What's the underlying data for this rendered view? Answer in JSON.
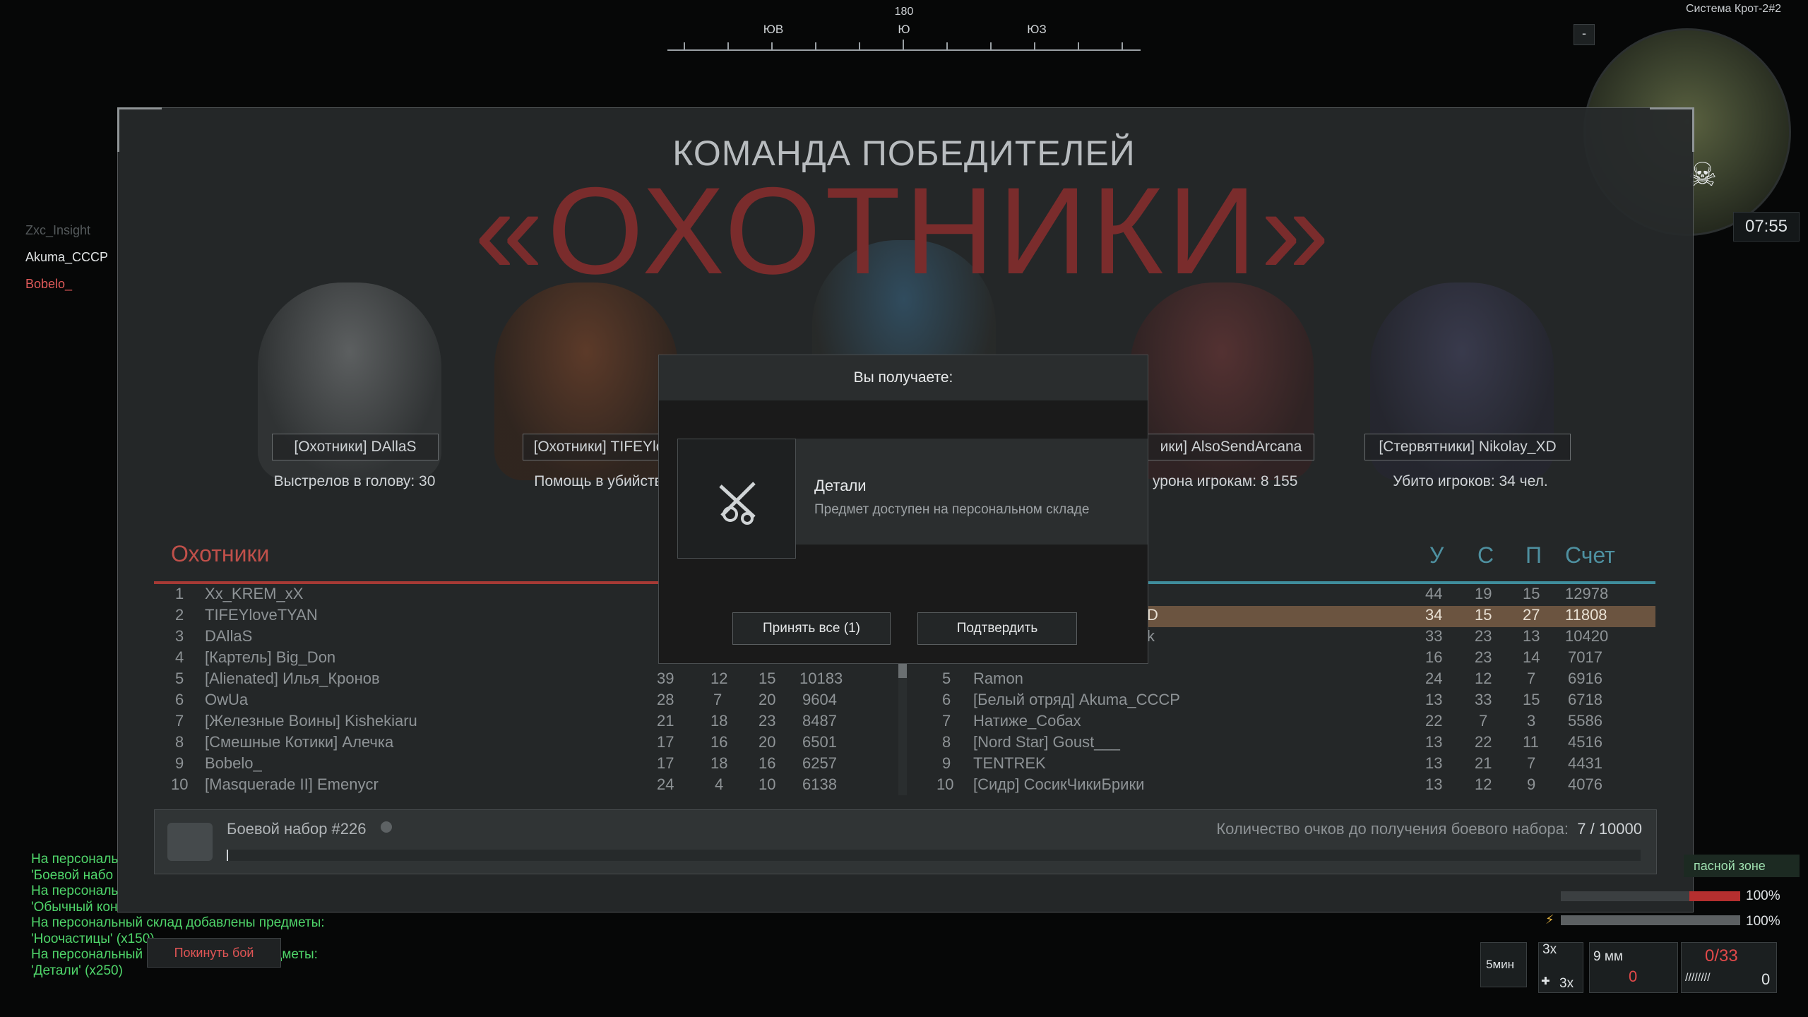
{
  "compass": {
    "degree": "180",
    "labels": [
      {
        "text": "ЮВ"
      },
      {
        "text": "Ю"
      },
      {
        "text": "ЮЗ"
      }
    ]
  },
  "minimap": {
    "title": "Система Крот-2#2",
    "zoom_out": "-",
    "time": "07:55"
  },
  "squad": [
    {
      "name": "Zxc_Insight",
      "color": "#555a5c"
    },
    {
      "name": "Akuma_CCCP",
      "color": "#e2e5e6"
    },
    {
      "name": "Bobelo_",
      "color": "#e05a5a"
    }
  ],
  "winner": {
    "subtitle": "КОМАНДА ПОБЕДИТЕЛЕЙ",
    "team": "«ОХОТНИКИ»"
  },
  "mvp": [
    {
      "player": "[Охотники] DAllaS",
      "stat": "Выстрелов в голову: 30"
    },
    {
      "player": "[Охотники] TIFEYlo",
      "stat": "Помощь в убийств"
    },
    {
      "player": "ики] AlsoSendArcana",
      "stat": "урона игрокам: 8 155"
    },
    {
      "player": "[Стервятники] Nikolay_XD",
      "stat": "Убито игроков: 34 чел."
    }
  ],
  "left_team": {
    "name": "Охотники",
    "rows": [
      {
        "n": "1",
        "name": "Xx_KREM_xX",
        "k": "",
        "d": "",
        "a": "",
        "s": ""
      },
      {
        "n": "2",
        "name": "TIFEYloveTYAN",
        "k": "",
        "d": "",
        "a": "",
        "s": ""
      },
      {
        "n": "3",
        "name": "DAllaS",
        "k": "",
        "d": "",
        "a": "",
        "s": ""
      },
      {
        "n": "4",
        "name": "[Картель] Big_Don",
        "k": "",
        "d": "",
        "a": "",
        "s": ""
      },
      {
        "n": "5",
        "name": "[Alienated] Илья_Кронов",
        "k": "39",
        "d": "12",
        "a": "15",
        "s": "10183"
      },
      {
        "n": "6",
        "name": "OwUa",
        "k": "28",
        "d": "7",
        "a": "20",
        "s": "9604"
      },
      {
        "n": "7",
        "name": "[Железные Воины] Kishekiaru",
        "k": "21",
        "d": "18",
        "a": "23",
        "s": "8487"
      },
      {
        "n": "8",
        "name": "[Смешные Котики] Алечка",
        "k": "17",
        "d": "16",
        "a": "20",
        "s": "6501"
      },
      {
        "n": "9",
        "name": "Bobelo_",
        "k": "17",
        "d": "18",
        "a": "16",
        "s": "6257"
      },
      {
        "n": "10",
        "name": "[Masquerade II] Emenycr",
        "k": "24",
        "d": "4",
        "a": "10",
        "s": "6138"
      }
    ]
  },
  "right_team": {
    "columns": {
      "kills": "У",
      "deaths": "С",
      "assists": "П",
      "score": "Счет"
    },
    "rows": [
      {
        "n": "",
        "name": "",
        "k": "44",
        "d": "19",
        "a": "15",
        "s": "12978"
      },
      {
        "n": "",
        "name": "D",
        "k": "34",
        "d": "15",
        "a": "27",
        "s": "11808"
      },
      {
        "n": "",
        "name": "k",
        "k": "33",
        "d": "23",
        "a": "13",
        "s": "10420"
      },
      {
        "n": "",
        "name": "",
        "k": "16",
        "d": "23",
        "a": "14",
        "s": "7017"
      },
      {
        "n": "5",
        "name": "Ramon",
        "k": "24",
        "d": "12",
        "a": "7",
        "s": "6916"
      },
      {
        "n": "6",
        "name": "[Белый отряд] Akuma_CCCP",
        "k": "13",
        "d": "33",
        "a": "15",
        "s": "6718"
      },
      {
        "n": "7",
        "name": "Натиже_Собах",
        "k": "22",
        "d": "7",
        "a": "3",
        "s": "5586"
      },
      {
        "n": "8",
        "name": "[Nord Star] Goust___",
        "k": "13",
        "d": "22",
        "a": "11",
        "s": "4516"
      },
      {
        "n": "9",
        "name": "TENTREK",
        "k": "13",
        "d": "21",
        "a": "7",
        "s": "4431"
      },
      {
        "n": "10",
        "name": "[Сидр] СосикЧикиБрики",
        "k": "13",
        "d": "12",
        "a": "9",
        "s": "4076"
      }
    ]
  },
  "kit": {
    "name": "Боевой набор #226",
    "points_label": "Количество очков до получения боевого набора:",
    "points_value": "7 / 10000",
    "progress": 0.0007
  },
  "reward": {
    "title": "Вы получаете:",
    "item_name": "Детали",
    "item_desc": "Предмет доступен на персональном складе",
    "accept_all": "Принять все (1)",
    "confirm": "Подтвердить"
  },
  "chat": [
    "На персональ",
    "'Боевой набо",
    "На персональ",
    "'Обычный кон",
    "На персональный склад добавлены предметы:",
    "'Ноочастицы' (х150)",
    "На персональный",
    "'Детали' (х250)"
  ],
  "chat_tail": "едметы:",
  "leave_button": "Покинуть бой",
  "hud": {
    "zone": "пасной зоне",
    "hp1": "100%",
    "hp2": "100%",
    "timer": "5мин",
    "grenade_count": "3х",
    "medkit_count": "3х",
    "ammo_type": "9 мм",
    "ammo_reserve": "0",
    "ammo": "0/33",
    "mag": "0"
  },
  "colors": {
    "accent_red": "#a63a35",
    "accent_blue": "#3f8d9c",
    "chat_green": "#4fd56a"
  }
}
